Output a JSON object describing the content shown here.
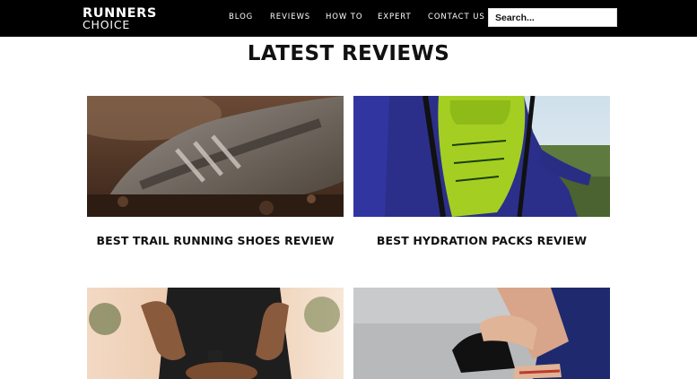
{
  "header": {
    "logo_top": "RUNNERS",
    "logo_bottom": "CHOICE",
    "nav": [
      "BLOG",
      "REVIEWS",
      "HOW TO",
      "EXPERT",
      "CONTACT US"
    ],
    "search_placeholder": "Search..."
  },
  "main": {
    "title": "LATEST REVIEWS",
    "cards": [
      {
        "title": "BEST TRAIL RUNNING SHOES REVIEW",
        "image": "muddy-trail-shoe-photo"
      },
      {
        "title": "BEST HYDRATION PACKS REVIEW",
        "image": "hydration-pack-runner-photo"
      },
      {
        "title": "",
        "image": "runner-back-pain-photo"
      },
      {
        "title": "",
        "image": "runner-ankle-sock-photo"
      }
    ]
  },
  "colors": {
    "header_bg": "#000000",
    "text": "#111111",
    "pack_green": "#a4cf22"
  }
}
